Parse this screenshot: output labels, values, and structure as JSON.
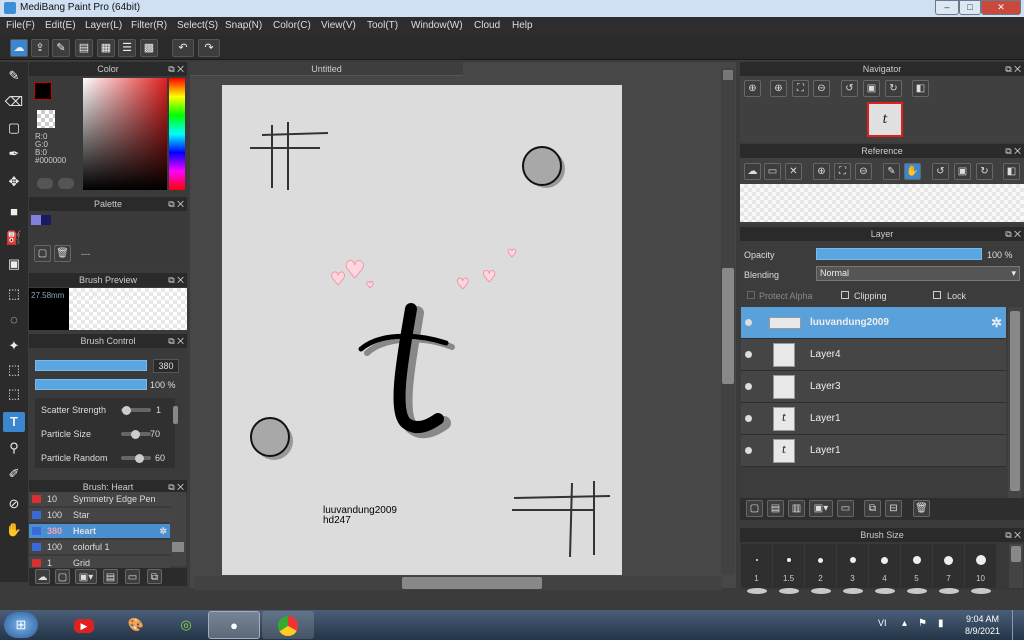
{
  "window": {
    "title": "MediBang Paint Pro (64bit)",
    "min": "–",
    "max": "□",
    "close": "✕"
  },
  "menu": [
    "File(F)",
    "Edit(E)",
    "Layer(L)",
    "Filter(R)",
    "Select(S)",
    "Snap(N)",
    "Color(C)",
    "View(V)",
    "Tool(T)",
    "Window(W)",
    "Cloud",
    "Help"
  ],
  "doc_tab": "Untitled",
  "color_panel": {
    "title": "Color",
    "r": "R:0",
    "g": "G:0",
    "b": "B:0",
    "hex": "#000000"
  },
  "palette": {
    "title": "Palette",
    "label": "---"
  },
  "brush_preview": {
    "title": "Brush Preview",
    "size": "27.58mm"
  },
  "brush_control": {
    "title": "Brush Control",
    "size_value": "380",
    "opacity_value": "100 %",
    "params": [
      {
        "label": "Scatter Strength",
        "value": "1"
      },
      {
        "label": "Particle Size",
        "value": "70"
      },
      {
        "label": "Particle Random",
        "value": "60"
      }
    ]
  },
  "brush_list": {
    "title": "Brush: Heart",
    "items": [
      {
        "size": "10",
        "name": "Symmetry Edge Pen",
        "color": "#d83030",
        "selected": false
      },
      {
        "size": "100",
        "name": "Star",
        "color": "#3a6ad8",
        "selected": false
      },
      {
        "size": "380",
        "name": "Heart",
        "color": "#3a6ad8",
        "selected": true
      },
      {
        "size": "100",
        "name": "colorful 1",
        "color": "#3a6ad8",
        "selected": false
      },
      {
        "size": "1",
        "name": "Grid",
        "color": "#d83030",
        "selected": false
      }
    ]
  },
  "canvas": {
    "letter": "t",
    "caption1": "luuvandung2009",
    "caption2": "hd247"
  },
  "navigator": {
    "title": "Navigator",
    "thumb_letter": "t"
  },
  "reference": {
    "title": "Reference"
  },
  "layer_panel": {
    "title": "Layer",
    "opacity_label": "Opacity",
    "opacity_value": "100 %",
    "blending_label": "Blending",
    "blending_value": "Normal",
    "protect_alpha": "Protect Alpha",
    "clipping": "Clipping",
    "lock": "Lock",
    "layers": [
      {
        "name": "luuvandung2009",
        "selected": true,
        "thumb": ""
      },
      {
        "name": "Layer4",
        "selected": false,
        "thumb": ""
      },
      {
        "name": "Layer3",
        "selected": false,
        "thumb": ""
      },
      {
        "name": "Layer1",
        "selected": false,
        "thumb": "t"
      },
      {
        "name": "Layer1",
        "selected": false,
        "thumb": "t"
      }
    ]
  },
  "brush_size": {
    "title": "Brush Size",
    "sizes": [
      "1",
      "1.5",
      "2",
      "3",
      "4",
      "5",
      "7",
      "10"
    ]
  },
  "taskbar": {
    "lang": "VI",
    "time": "9:04 AM",
    "date": "8/9/2021"
  }
}
